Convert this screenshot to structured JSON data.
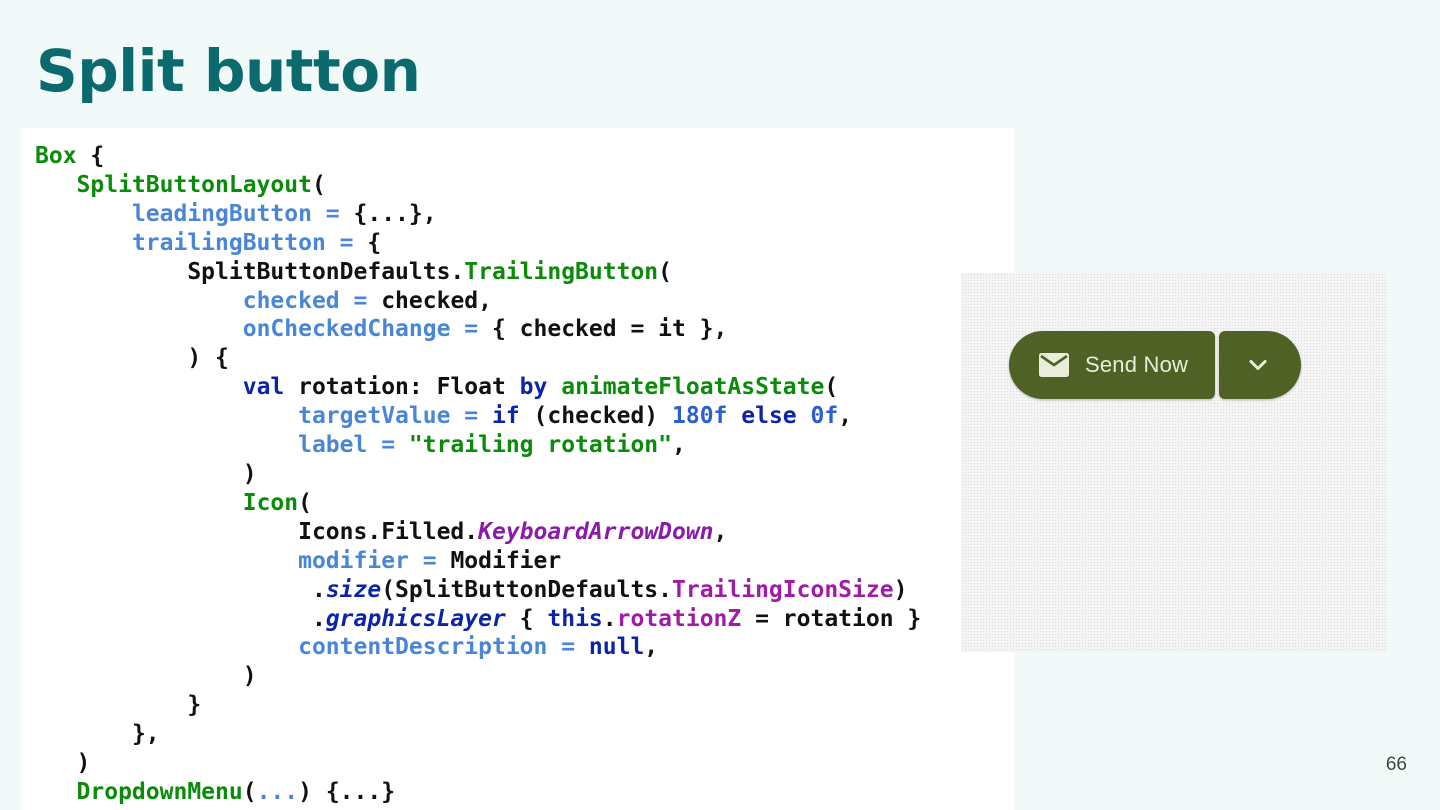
{
  "slide": {
    "title": "Split button",
    "page_number": "66"
  },
  "preview": {
    "leading_button_label": "Send Now",
    "leading_icon": "mail-icon",
    "trailing_icon": "chevron-down-icon",
    "button_color": "#4f6124",
    "button_text_color": "#e9eedb"
  },
  "code": {
    "l1": [
      "Box",
      " {"
    ],
    "l2": [
      "   ",
      "SplitButtonLayout",
      "("
    ],
    "l3": [
      "       ",
      "leadingButton = ",
      "{...},"
    ],
    "l4": [
      "       ",
      "trailingButton = ",
      "{"
    ],
    "l5": [
      "           ",
      "SplitButtonDefaults.",
      "TrailingButton",
      "("
    ],
    "l6": [
      "               ",
      "checked = ",
      "checked,"
    ],
    "l7": [
      "               ",
      "onCheckedChange = ",
      "{ checked = it },"
    ],
    "l8": [
      "           ",
      ") {"
    ],
    "l9": [
      "               ",
      "val",
      " rotation: Float ",
      "by",
      " ",
      "animateFloatAsState",
      "("
    ],
    "l10": [
      "                   ",
      "targetValue = ",
      "if",
      " (checked) ",
      "180f",
      " ",
      "else",
      " ",
      "0f",
      ","
    ],
    "l11": [
      "                   ",
      "label = ",
      "\"trailing rotation\"",
      ","
    ],
    "l12": [
      "               ",
      ")"
    ],
    "l13": [
      "               ",
      "Icon",
      "("
    ],
    "l14": [
      "                   ",
      "Icons.Filled.",
      "KeyboardArrowDown",
      ","
    ],
    "l15": [
      "                   ",
      "modifier = ",
      "Modifier"
    ],
    "l16": [
      "                    ",
      ".",
      "size",
      "(SplitButtonDefaults.",
      "TrailingIconSize",
      ")"
    ],
    "l17": [
      "                    ",
      ".",
      "graphicsLayer",
      " { ",
      "this",
      ".",
      "rotationZ",
      " = rotation }"
    ],
    "l18": [
      "                   ",
      "contentDescription = ",
      "null",
      ","
    ],
    "l19": [
      "               ",
      ")"
    ],
    "l20": [
      "           ",
      "}"
    ],
    "l21": [
      "       ",
      "},"
    ],
    "l22": [
      "   ",
      ")"
    ],
    "l23": [
      "   ",
      "DropdownMenu",
      "(",
      "...",
      ") {...}"
    ]
  }
}
